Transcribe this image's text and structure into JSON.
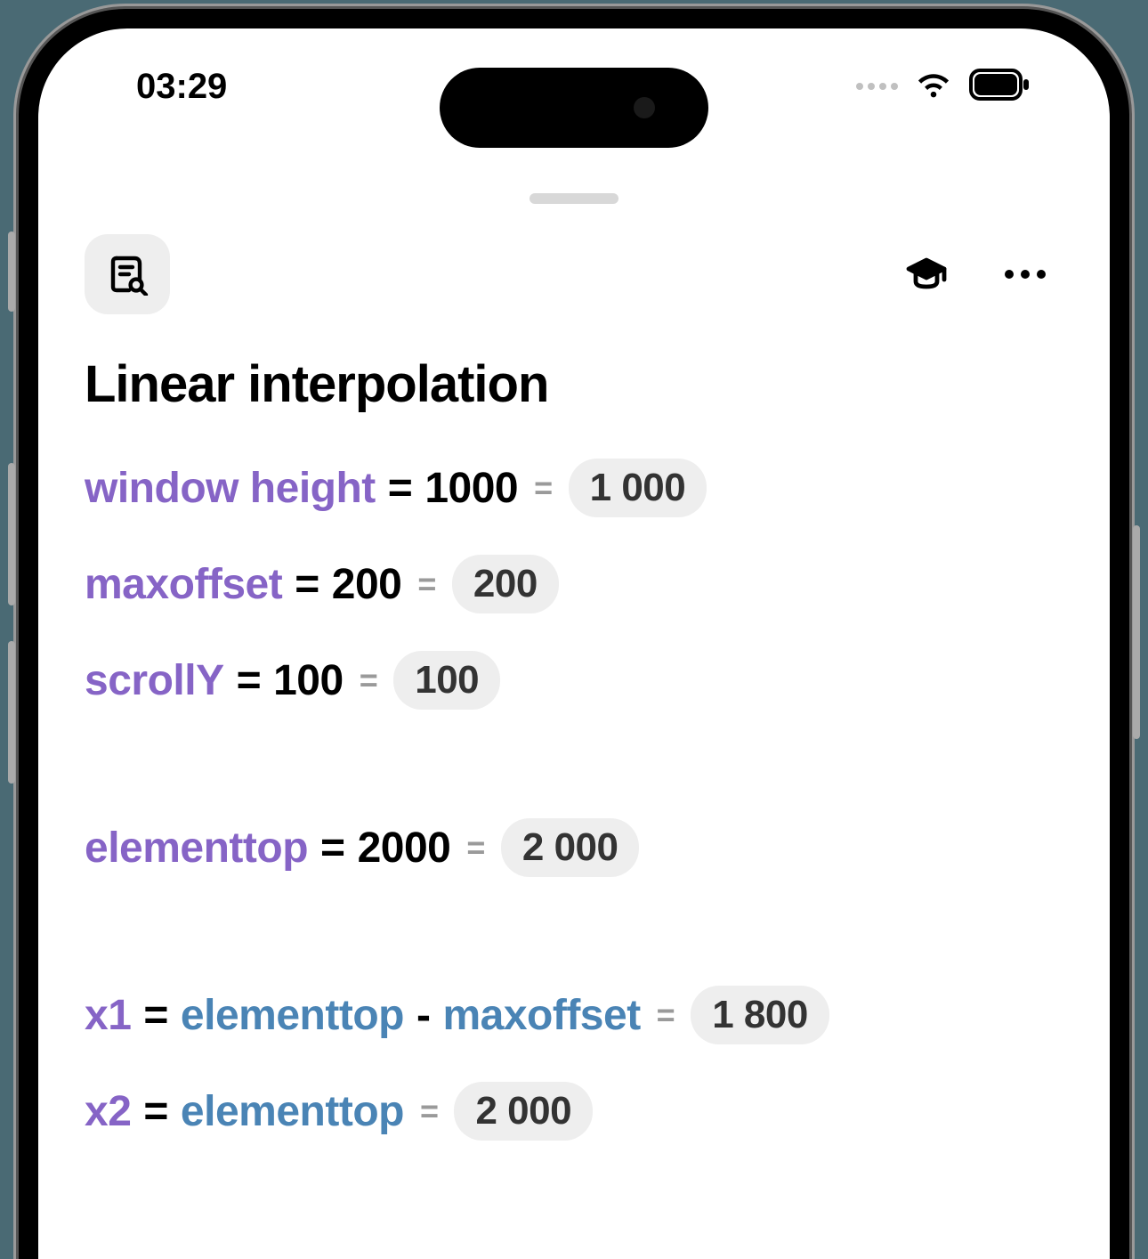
{
  "status_bar": {
    "time": "03:29"
  },
  "toolbar": {
    "icons": {
      "search_doc": "document-search-icon",
      "education": "graduation-cap-icon",
      "more": "more-icon"
    }
  },
  "document": {
    "title": "Linear interpolation",
    "lines": [
      {
        "type": "assign",
        "var": "window height",
        "expr": [
          {
            "kind": "val",
            "text": "1000"
          }
        ],
        "result": "1 000"
      },
      {
        "type": "assign",
        "var": "maxoffset",
        "expr": [
          {
            "kind": "val",
            "text": "200"
          }
        ],
        "result": "200"
      },
      {
        "type": "assign",
        "var": "scrollY",
        "expr": [
          {
            "kind": "val",
            "text": "100"
          }
        ],
        "result": "100"
      },
      {
        "type": "gap"
      },
      {
        "type": "assign",
        "var": "elementtop",
        "expr": [
          {
            "kind": "val",
            "text": "2000"
          }
        ],
        "result": "2 000"
      },
      {
        "type": "gap"
      },
      {
        "type": "assign",
        "var": "x1",
        "expr": [
          {
            "kind": "ref",
            "text": "elementtop"
          },
          {
            "kind": "op",
            "text": "-"
          },
          {
            "kind": "ref",
            "text": "maxoffset"
          }
        ],
        "result": "1 800"
      },
      {
        "type": "assign",
        "var": "x2",
        "expr": [
          {
            "kind": "ref",
            "text": "elementtop"
          }
        ],
        "result": "2 000"
      }
    ]
  }
}
